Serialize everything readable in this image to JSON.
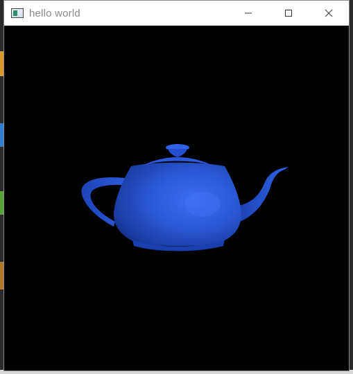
{
  "window": {
    "title": "hello world",
    "app_icon": "app-window-icon",
    "controls": [
      {
        "name": "minimize-button",
        "icon": "minimize-icon"
      },
      {
        "name": "maximize-button",
        "icon": "maximize-icon"
      },
      {
        "name": "close-button",
        "icon": "close-icon"
      }
    ]
  },
  "scene": {
    "background_color": "#000000",
    "object": "teapot",
    "object_color": "#2a59d8"
  }
}
